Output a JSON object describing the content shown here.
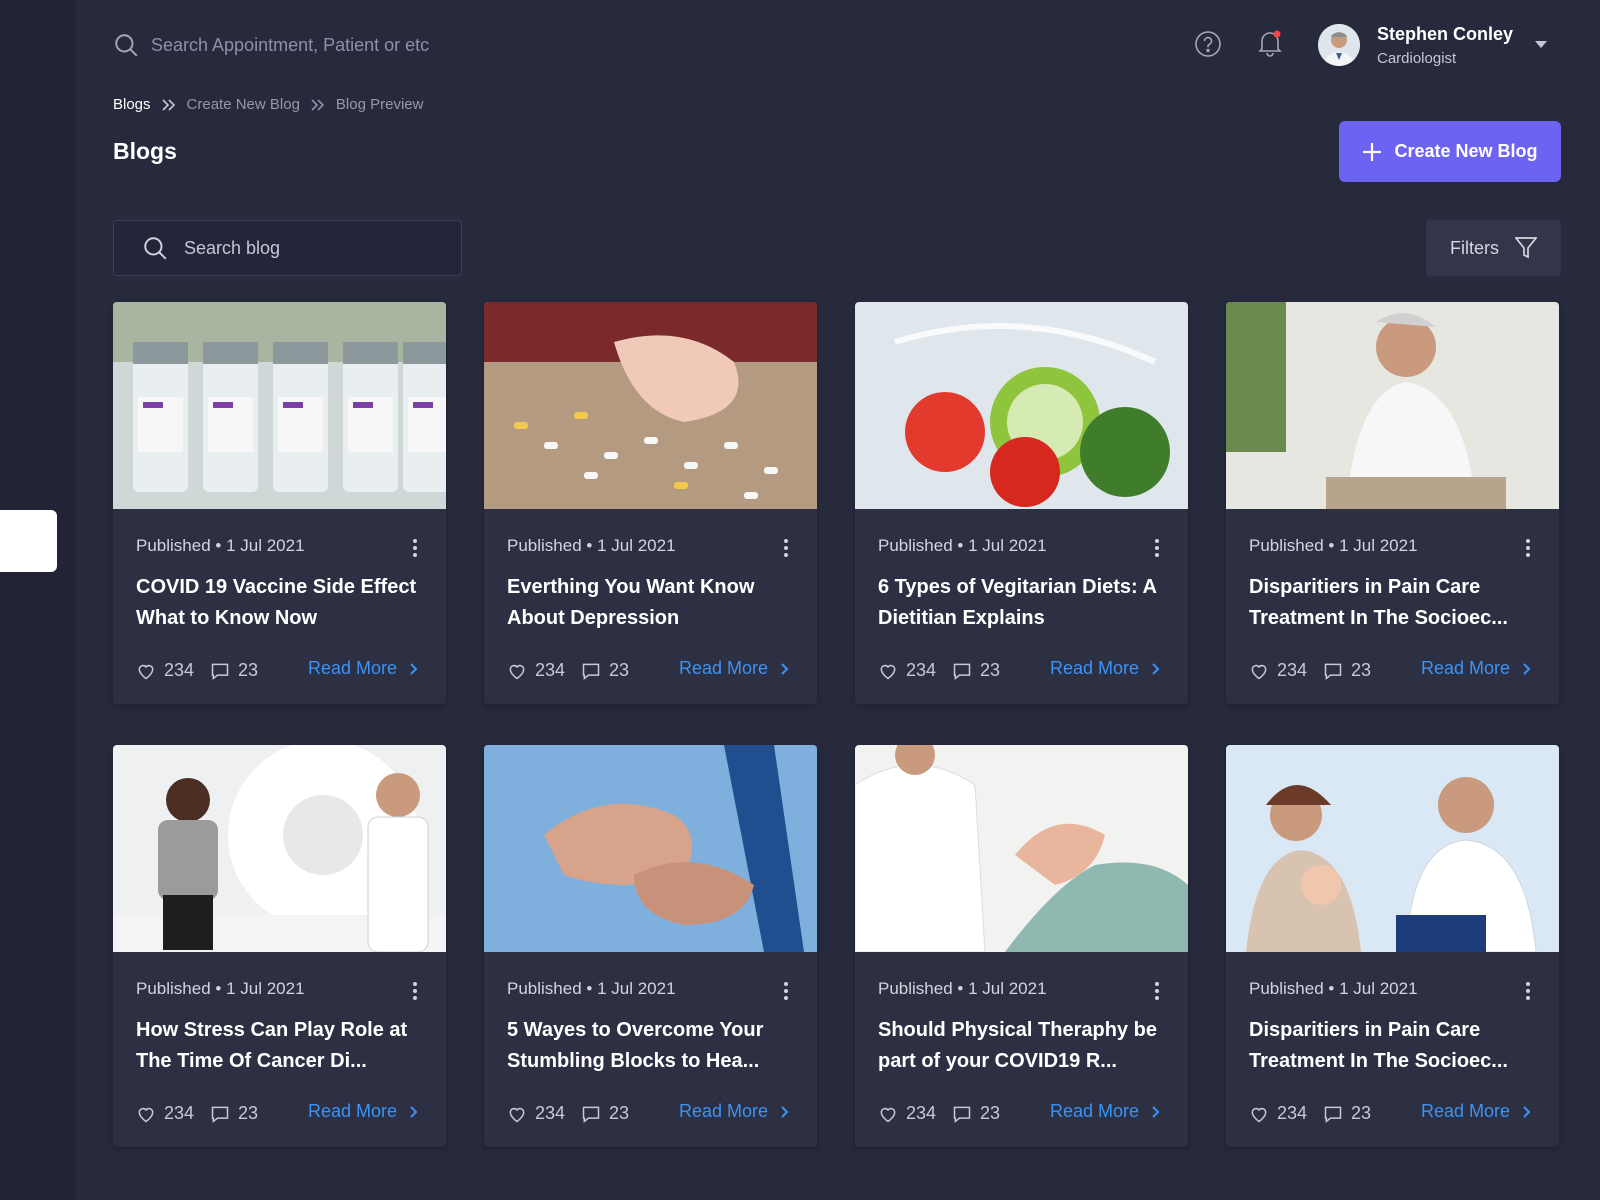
{
  "header": {
    "search_placeholder": "Search Appointment, Patient or etc",
    "user": {
      "name": "Stephen Conley",
      "role": "Cardiologist"
    }
  },
  "breadcrumb": [
    "Blogs",
    "Create New Blog",
    "Blog Preview"
  ],
  "page_title": "Blogs",
  "create_button": "Create New Blog",
  "blog_search_placeholder": "Search blog",
  "filters_label": "Filters",
  "read_more_label": "Read More",
  "colors": {
    "accent": "#6c63f2",
    "link": "#3a93f5",
    "background": "#272a3d",
    "card": "#2d3043"
  },
  "cards": [
    {
      "status": "Published",
      "date": "1 Jul 2021",
      "title": "COVID 19 Vaccine Side Effect What to Know Now",
      "likes": "234",
      "comments": "23"
    },
    {
      "status": "Published",
      "date": "1 Jul 2021",
      "title": "Everthing You Want Know About Depression",
      "likes": "234",
      "comments": "23"
    },
    {
      "status": "Published",
      "date": "1 Jul 2021",
      "title": "6 Types of Vegitarian Diets: A Dietitian Explains",
      "likes": "234",
      "comments": "23"
    },
    {
      "status": "Published",
      "date": "1 Jul 2021",
      "title": "Disparitiers in Pain Care Treatment In The Socioec...",
      "likes": "234",
      "comments": "23"
    },
    {
      "status": "Published",
      "date": "1 Jul 2021",
      "title": "How Stress Can Play Role at The Time Of Cancer Di...",
      "likes": "234",
      "comments": "23"
    },
    {
      "status": "Published",
      "date": "1 Jul 2021",
      "title": "5 Wayes to Overcome Your Stumbling Blocks to Hea...",
      "likes": "234",
      "comments": "23"
    },
    {
      "status": "Published",
      "date": "1 Jul 2021",
      "title": "Should Physical Theraphy be part of your COVID19 R...",
      "likes": "234",
      "comments": "23"
    },
    {
      "status": "Published",
      "date": "1 Jul 2021",
      "title": "Disparitiers in Pain Care Treatment In The Socioec...",
      "likes": "234",
      "comments": "23"
    }
  ]
}
